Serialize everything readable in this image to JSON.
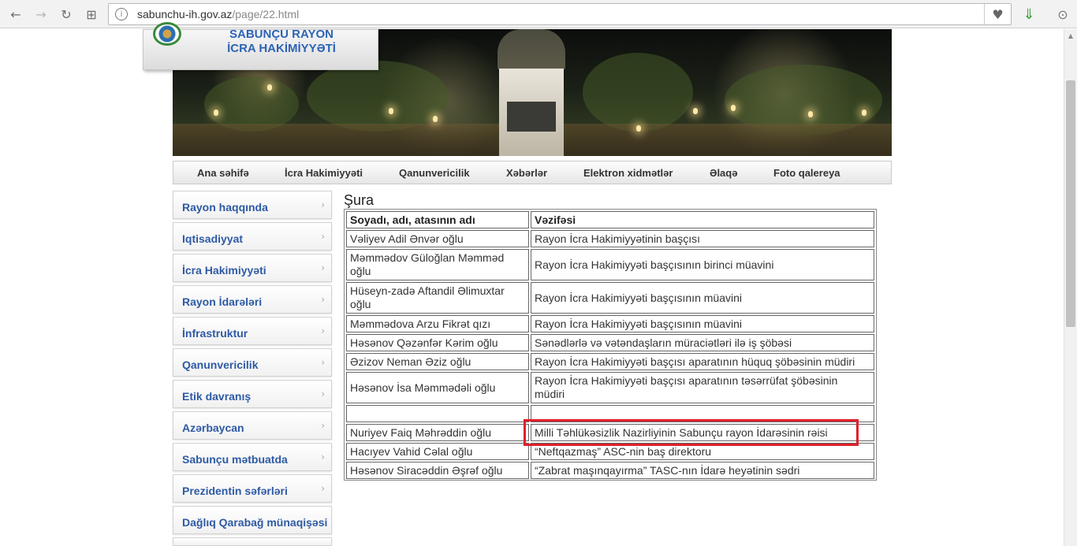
{
  "browser": {
    "url_host": "sabunchu-ih.gov.az",
    "url_path": "/page/22.html"
  },
  "site": {
    "logo_line1": "SABUNÇU RAYON",
    "logo_line2": "İCRA HAKİMİYYƏTİ"
  },
  "topmenu": [
    "Ana səhifə",
    "İcra Hakimiyyəti",
    "Qanunvericilik",
    "Xəbərlər",
    "Elektron xidmətlər",
    "Əlaqə",
    "Foto qalereya"
  ],
  "sidebar": [
    "Rayon haqqında",
    "Iqtisadiyyat",
    "İcra Hakimiyyəti",
    "Rayon İdarələri",
    "İnfrastruktur",
    "Qanunvericilik",
    "Etik davranış",
    "Azərbaycan",
    "Sabunçu mətbuatda",
    "Prezidentin səfərləri",
    "Dağlıq Qarabağ münaqişəsi"
  ],
  "content": {
    "title": "Şura",
    "columns": [
      "Soyadı, adı, atasının adı",
      "Vəzifəsi"
    ],
    "rows": [
      [
        "Vəliyev Adil Ənvər oğlu",
        "Rayon İcra Hakimiyyətinin başçısı"
      ],
      [
        "Məmmədov Güloğlan Məmməd oğlu",
        "Rayon İcra Hakimiyyəti başçısının birinci müavini"
      ],
      [
        "Hüseyn-zadə Aftandil Əlimuxtar oğlu",
        "Rayon İcra Hakimiyyəti başçısının müavini"
      ],
      [
        "Məmmədova Arzu Fikrət qızı",
        "Rayon İcra Hakimiyyəti başçısının müavini"
      ],
      [
        "Həsənov Qəzənfər Kərim oğlu",
        "Sənədlərlə və vətəndaşların müraciətləri ilə iş şöbəsi"
      ],
      [
        "Əzizov Neman Əziz oğlu",
        "Rayon İcra Hakimiyyəti başçısı aparatının hüquq şöbəsinin müdiri"
      ],
      [
        "Həsənov İsa Məmmədəli oğlu",
        "Rayon İcra Hakimiyyəti başçısı aparatının təsərrüfat şöbəsinin müdiri"
      ],
      [
        "",
        ""
      ],
      [
        "Nuriyev Faiq Məhrəddin oğlu",
        "Milli Təhlükəsizlik Nazirliyinin Sabunçu rayon İdarəsinin rəisi"
      ],
      [
        "Hacıyev Vahid Cəlal oğlu",
        "“Neftqazmaş” ASC-nin baş direktoru"
      ],
      [
        "Həsənov Siracəddin Əşrəf oğlu",
        "“Zabrat maşınqayırma” TASC-nın İdarə heyətinin sədri"
      ]
    ]
  },
  "colors": {
    "link_blue": "#2e5aa5",
    "highlight_red": "#e0202a"
  }
}
